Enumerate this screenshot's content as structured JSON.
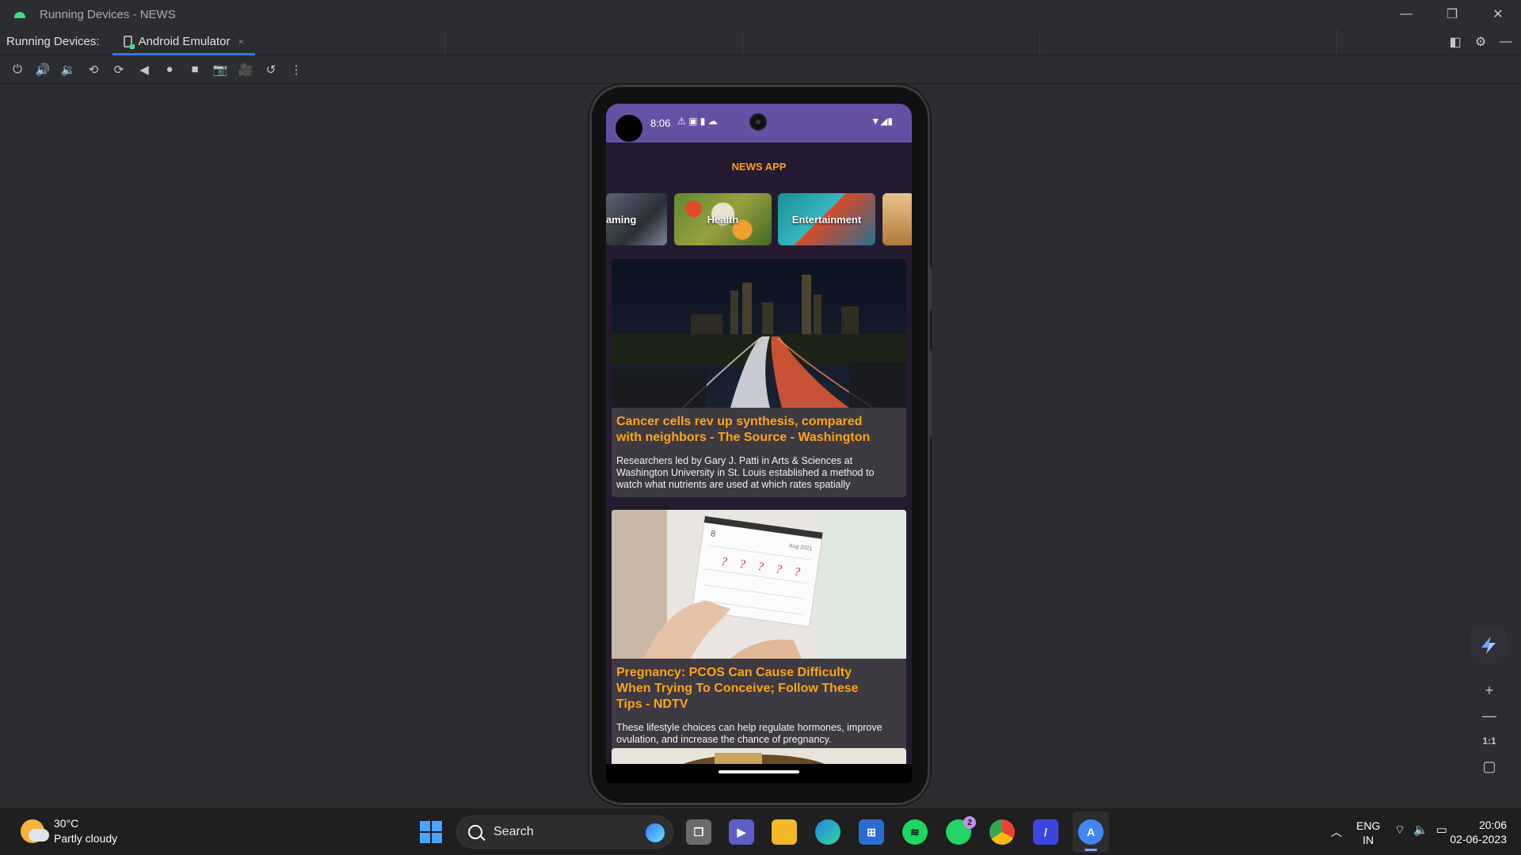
{
  "window": {
    "title": "Running Devices - NEWS",
    "controls": {
      "minimize": "—",
      "restore": "❐",
      "close": "✕"
    }
  },
  "tabbar": {
    "label": "Running Devices:",
    "tab": {
      "label": "Android Emulator",
      "close": "×"
    }
  },
  "toolbar": {
    "icons": [
      "power-icon",
      "volume-up-icon",
      "volume-down-icon",
      "rotate-left-icon",
      "rotate-right-icon",
      "back-icon",
      "home-icon",
      "overview-icon",
      "screenshot-icon",
      "record-icon",
      "reset-icon",
      "more-icon"
    ],
    "glyphs": [
      "⏻",
      "🔊",
      "🔉",
      "⟲",
      "⟳",
      "◀",
      "●",
      "■",
      "📷",
      "🎥",
      "↺",
      "⋮"
    ]
  },
  "device": {
    "status": {
      "time": "8:06",
      "left_icons": "⚠ ▣ ▮ ☁",
      "right_icons": "▼◢▮"
    },
    "app_title": "NEWS APP",
    "categories": [
      {
        "label": "Gaming",
        "shown": "aming",
        "color": "#3b4048"
      },
      {
        "label": "Health",
        "shown": "Health",
        "color": "#6a8b3a"
      },
      {
        "label": "Entertainment",
        "shown": "Entertainment",
        "color": "#2aa0a8"
      },
      {
        "label": "",
        "shown": "",
        "color": "#c98a3a"
      }
    ],
    "articles": [
      {
        "headline": "Cancer cells rev up synthesis, compared with neighbors - The Source - Washington",
        "description": "Researchers led by Gary J. Patti in Arts & Sciences at Washington University in St. Louis established a method to watch what nutrients are used at which rates spatially"
      },
      {
        "headline": "Pregnancy: PCOS Can Cause Difficulty When Trying To Conceive; Follow These Tips - NDTV",
        "description": "These lifestyle choices can help regulate hormones, improve ovulation, and increase the chance of pregnancy."
      }
    ],
    "calendar_marks": "? ? ? ? ?",
    "calendar_month": "Aug 2021",
    "calendar_day": "8"
  },
  "zoom_controls": {
    "zoom_in": "+",
    "zoom_out": "—",
    "actual_size": "1:1",
    "fit": "▢"
  },
  "taskbar": {
    "weather": {
      "temp": "30°C",
      "condition": "Partly cloudy"
    },
    "search_placeholder": "Search",
    "whatsapp_badge": "2",
    "language": "ENG",
    "region": "IN",
    "time": "20:06",
    "date": "02-06-2023",
    "colors": {
      "accent": "#3574f0",
      "orange": "#ffa41b",
      "status_bar": "#6650a4"
    }
  }
}
